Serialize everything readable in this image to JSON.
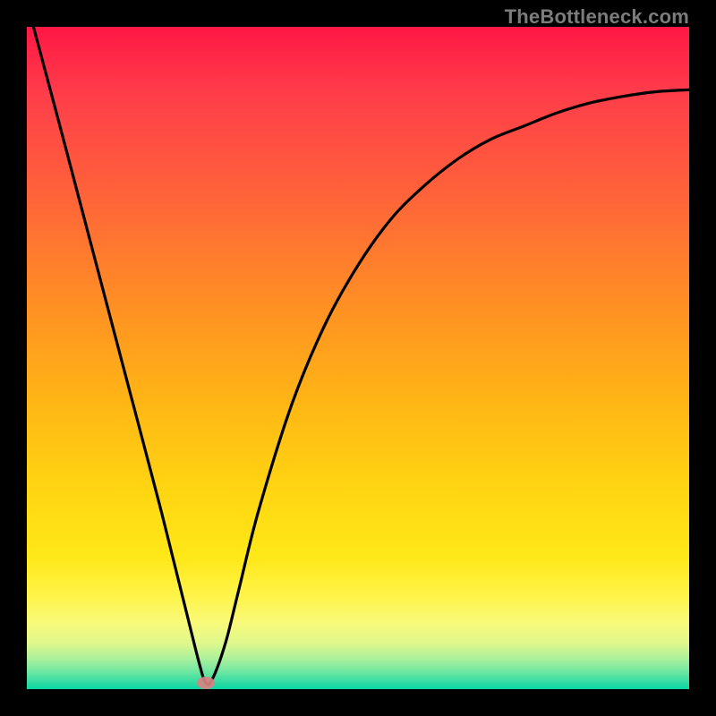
{
  "watermark": "TheBottleneck.com",
  "chart_data": {
    "type": "line",
    "title": "",
    "xlabel": "",
    "ylabel": "",
    "xlim": [
      0,
      1
    ],
    "ylim": [
      0,
      1
    ],
    "series": [
      {
        "name": "curve",
        "x": [
          0.01,
          0.05,
          0.1,
          0.15,
          0.2,
          0.24,
          0.26,
          0.27,
          0.28,
          0.3,
          0.32,
          0.35,
          0.4,
          0.45,
          0.5,
          0.55,
          0.6,
          0.65,
          0.7,
          0.75,
          0.8,
          0.85,
          0.9,
          0.95,
          1.0
        ],
        "y": [
          1.0,
          0.85,
          0.66,
          0.47,
          0.28,
          0.12,
          0.04,
          0.01,
          0.015,
          0.07,
          0.15,
          0.27,
          0.43,
          0.55,
          0.64,
          0.71,
          0.76,
          0.8,
          0.83,
          0.85,
          0.87,
          0.885,
          0.895,
          0.902,
          0.905
        ]
      }
    ],
    "marker": {
      "x": 0.27,
      "y": 0.01
    },
    "gradient_colors": {
      "top": "#ff1744",
      "mid": "#ffd512",
      "bottom": "#0cd6a4"
    }
  }
}
